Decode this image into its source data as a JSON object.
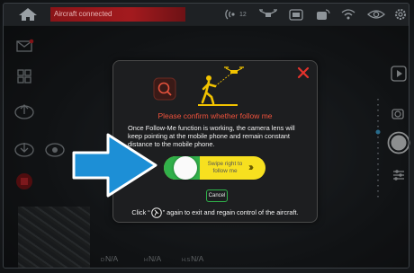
{
  "topbar": {
    "status_text": "Aircraft connected",
    "signal_count": "12"
  },
  "dialog": {
    "title": "Please confirm whether follow me",
    "description": "Once Follow-Me function is working, the camera lens will keep pointing at the mobile phone and remain constant distance to the mobile phone.",
    "slider_text": "Swipe right to follow me",
    "cancel_label": "Cancel",
    "hint_prefix": "Click “",
    "hint_suffix": "” again to exit and regain control of the aircraft."
  },
  "telemetry": [
    {
      "label": "D",
      "value": "N/A"
    },
    {
      "label": "H",
      "value": "N/A"
    },
    {
      "label": "H.S",
      "value": "N/A"
    }
  ],
  "colors": {
    "status_red": "#a31a1e",
    "title_red": "#f0523c",
    "slider_yellow": "#f7e01f",
    "slider_green": "#31b04a",
    "arrow_blue": "#1d8fd6"
  },
  "icons": [
    "home-icon",
    "signal-icon",
    "drone-icon",
    "battery-icon",
    "camera-signal-icon",
    "wifi-icon",
    "eye-icon",
    "settings-icon",
    "mail-icon",
    "grid-icon",
    "takeoff-icon",
    "land-icon",
    "follow-me-icon",
    "record-icon",
    "close-icon",
    "shutter-icon"
  ]
}
